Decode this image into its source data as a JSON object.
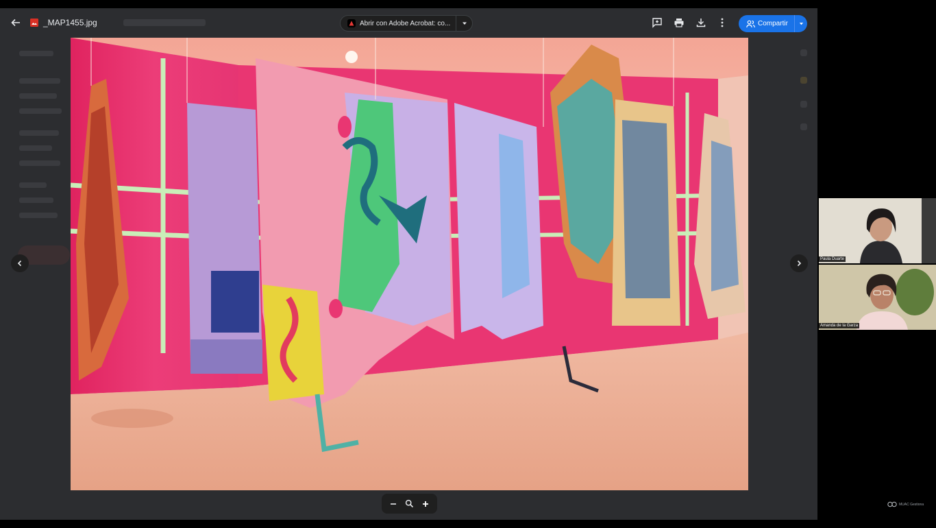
{
  "toolbar": {
    "back_icon": "arrow-left-icon",
    "file_type_icon": "image-file-icon",
    "file_name": "_MAP1455.jpg",
    "open_with_label": "Abrir con Adobe Acrobat: co...",
    "open_with_icon": "acrobat-icon",
    "open_with_dropdown_icon": "caret-down-icon",
    "add_comment_icon": "add-comment-icon",
    "print_icon": "print-icon",
    "download_icon": "download-icon",
    "more_icon": "more-vert-icon",
    "share_label": "Compartir",
    "share_icon": "people-icon"
  },
  "colors": {
    "screen_bg": "#2c2d30",
    "share_blue": "#1a73e8",
    "wall_pink": "#e8336f",
    "floor_peach": "#e9ad95"
  },
  "navigation": {
    "prev_icon": "chevron-left-icon",
    "next_icon": "chevron-right-icon"
  },
  "zoom": {
    "zoom_out_icon": "minus-icon",
    "zoom_reset_icon": "magnifier-icon",
    "zoom_in_icon": "plus-icon"
  },
  "participants": [
    {
      "name": "Paula Duarte"
    },
    {
      "name": "Amanda de la Garza"
    }
  ],
  "brand": {
    "label": "MUAC Gestiona",
    "icon": "brand-logo-icon"
  }
}
